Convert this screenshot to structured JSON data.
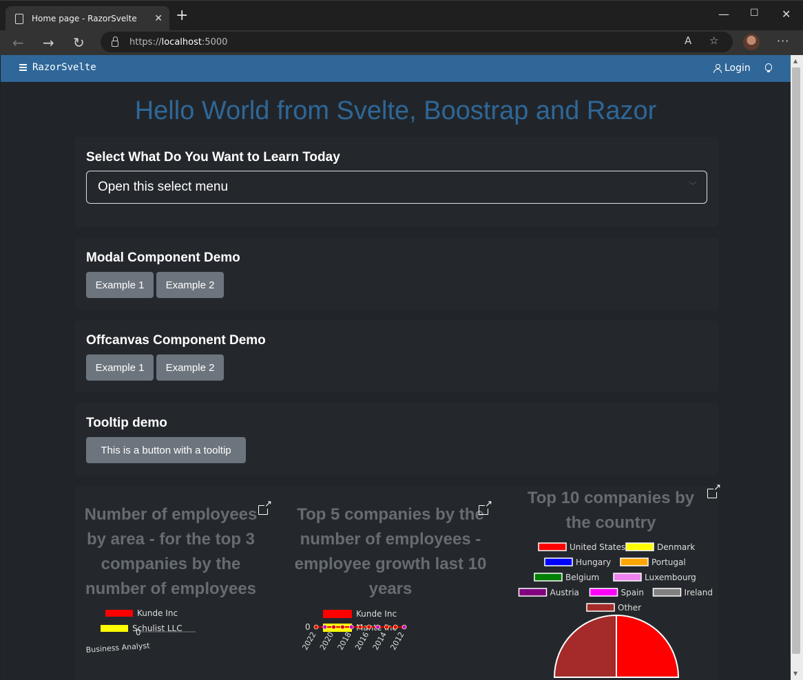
{
  "browser": {
    "tab_title": "Home page - RazorSvelte",
    "url_scheme": "https://",
    "url_host": "localhost",
    "url_port": ":5000"
  },
  "nav": {
    "brand": "RazorSvelte",
    "login": "Login"
  },
  "hero": {
    "title": "Hello World from Svelte, Boostrap and Razor"
  },
  "learn": {
    "title": "Select What Do You Want to Learn Today",
    "select_value": "Open this select menu"
  },
  "modal": {
    "title": "Modal Component Demo",
    "btn1": "Example 1",
    "btn2": "Example 2"
  },
  "offcanvas": {
    "title": "Offcanvas Component Demo",
    "btn1": "Example 1",
    "btn2": "Example 2"
  },
  "tooltip": {
    "title": "Tooltip demo",
    "button": "This is a button with a tooltip"
  },
  "chart_data": [
    {
      "type": "bar",
      "title": "Number of employees by area - for the top 3 companies by the number of employees",
      "series": [
        {
          "name": "Kunde Inc",
          "color": "#ff0000"
        },
        {
          "name": "Schulist LLC",
          "color": "#ffff00"
        }
      ],
      "categories": [
        "Business Analyst"
      ],
      "ytick": "0"
    },
    {
      "type": "line",
      "title": "Top 5 companies by the number of employees - employee growth last 10 years",
      "series": [
        {
          "name": "Kunde Inc",
          "color": "#ff0000"
        },
        {
          "name": "Mante Inc",
          "color": "#ffff00"
        }
      ],
      "x": [
        "2022",
        "2020",
        "2018",
        "2016",
        "2014",
        "2012"
      ],
      "ytick": "0"
    },
    {
      "type": "pie",
      "title": "Top 10 companies by the country",
      "labels": [
        "United States",
        "Denmark",
        "Hungary",
        "Portugal",
        "Belgium",
        "Luxembourg",
        "Austria",
        "Spain",
        "Ireland",
        "Other"
      ],
      "colors": [
        "#ff0000",
        "#ffff00",
        "#0000ff",
        "#ffa500",
        "#008000",
        "#ee82ee",
        "#800080",
        "#ff00ff",
        "#808080",
        "#a52a2a"
      ]
    }
  ]
}
